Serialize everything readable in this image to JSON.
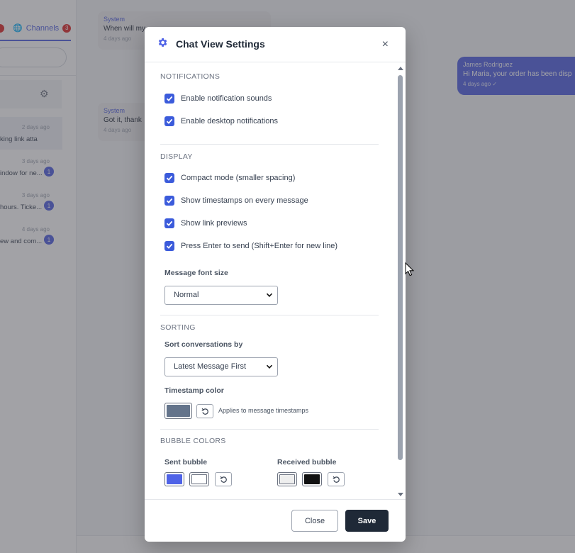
{
  "background": {
    "channels_tab": {
      "label": "Channels",
      "count": "3"
    },
    "conversations": [
      {
        "time": "2 days ago",
        "snippet": "king link atta",
        "unread": ""
      },
      {
        "time": "3 days ago",
        "snippet": "indow for ne...",
        "unread": "1"
      },
      {
        "time": "3 days ago",
        "snippet": " hours. Ticke...",
        "unread": "1"
      },
      {
        "time": "4 days ago",
        "snippet": "ew and com...",
        "unread": "1"
      }
    ],
    "messages": [
      {
        "sender": "System",
        "body": "When will my",
        "time": "4 days ago"
      },
      {
        "sender": "System",
        "body": "Got it, thank",
        "time": "4 days ago"
      }
    ],
    "outgoing": {
      "sender": "James Rodriguez",
      "body": "Hi Maria, your order has been disp",
      "time": "4 days ago"
    }
  },
  "modal": {
    "title": "Chat View Settings",
    "close_icon": "×",
    "sections": {
      "notifications": {
        "title": "NOTIFICATIONS",
        "options": [
          {
            "label": "Enable notification sounds",
            "checked": true
          },
          {
            "label": "Enable desktop notifications",
            "checked": true
          }
        ]
      },
      "display": {
        "title": "DISPLAY",
        "options": [
          {
            "label": "Compact mode (smaller spacing)",
            "checked": true
          },
          {
            "label": "Show timestamps on every message",
            "checked": true
          },
          {
            "label": "Show link previews",
            "checked": true
          },
          {
            "label": "Press Enter to send (Shift+Enter for new line)",
            "checked": true
          }
        ],
        "font_size_label": "Message font size",
        "font_size_value": "Normal"
      },
      "sorting": {
        "title": "SORTING",
        "sort_label": "Sort conversations by",
        "sort_value": "Latest Message First",
        "timestamp_color_label": "Timestamp color",
        "timestamp_color": "#64748b",
        "timestamp_hint": "Applies to message timestamps"
      },
      "bubble_colors": {
        "title": "BUBBLE COLORS",
        "sent_label": "Sent bubble",
        "sent_bg": "#4f63e7",
        "sent_text": "#ffffff",
        "received_label": "Received bubble",
        "received_bg": "#eeeeee",
        "received_text": "#111111"
      }
    },
    "footer": {
      "close_label": "Close",
      "save_label": "Save"
    }
  },
  "colors": {
    "accent": "#3b5bdb",
    "save_button": "#1f2937",
    "badge_red": "#dc2626"
  }
}
